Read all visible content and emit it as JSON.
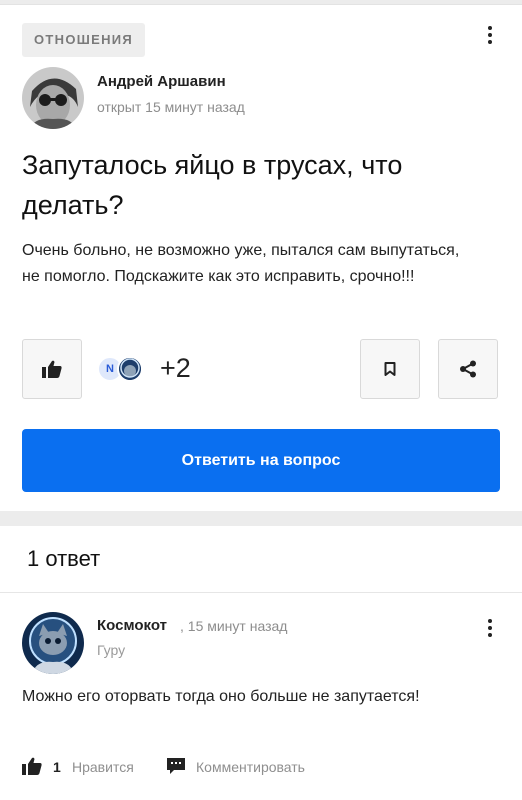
{
  "question": {
    "category": "ОТНОШЕНИЯ",
    "author_name": "Андрей Аршавин",
    "opened": "открыт 15 минут назад",
    "title": "Запуталось яйцо в трусах, что делать?",
    "text": "Очень больно, не возможно уже, пытался сам выпутаться, не помогло. Подскажите как это исправить, срочно!!!",
    "avatar_letter": "N",
    "others_count": "+2",
    "answer_button": "Ответить на вопрос"
  },
  "answers": {
    "count_label": "1 ответ",
    "items": [
      {
        "author_name": "Космокот",
        "time": ", 15 минут назад",
        "role": "Гуру",
        "text": "Можно его оторвать тогда оно больше не запутается!",
        "likes": "1",
        "like_label": "Нравится",
        "comment_label": "Комментировать"
      }
    ]
  },
  "colors": {
    "accent": "#0a6ff0",
    "background": "#ececec",
    "card": "#ffffff",
    "muted_text": "#8d8d8d"
  },
  "icons": [
    "kebab-menu-icon",
    "thumbs-up-icon",
    "bookmark-icon",
    "share-icon",
    "comment-icon"
  ]
}
